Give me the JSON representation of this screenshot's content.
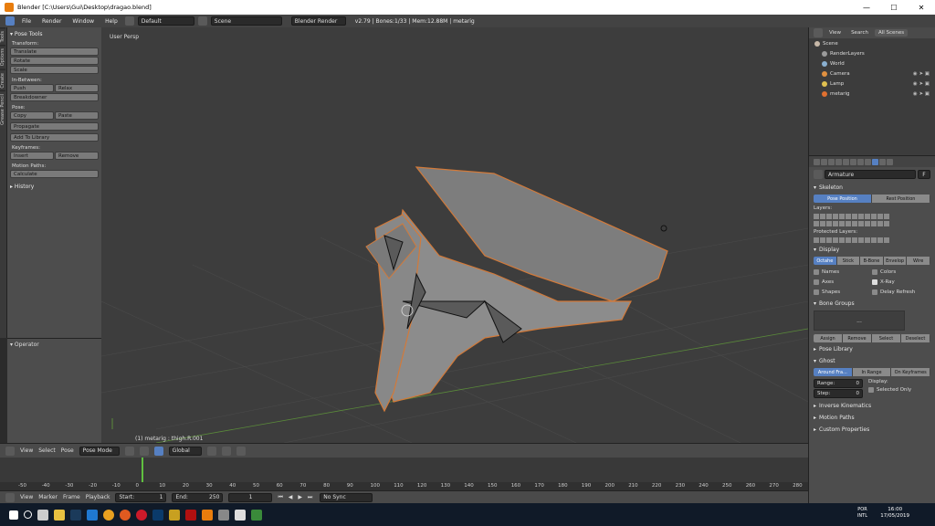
{
  "window": {
    "title": "Blender [C:\\Users\\Gui\\Desktop\\dragao.blend]",
    "minimize": "—",
    "maximize": "☐",
    "close": "✕"
  },
  "topbar": {
    "menus": [
      "File",
      "Render",
      "Window",
      "Help"
    ],
    "layout": "Default",
    "scene": "Scene",
    "engine": "Blender Render",
    "stats": "v2.79 | Bones:1/33 | Mem:12.88M | metarig"
  },
  "tooltabs": [
    "Tools",
    "Options",
    "Create",
    "Grease Pencil"
  ],
  "toolshelf": {
    "header": "▾ Pose Tools",
    "transform_label": "Transform:",
    "translate": "Translate",
    "rotate": "Rotate",
    "scale": "Scale",
    "inbetween_label": "In-Between:",
    "push": "Push",
    "relax": "Relax",
    "breakdowner": "Breakdowner",
    "pose_label": "Pose:",
    "copy": "Copy",
    "paste": "Paste",
    "propagate": "Propagate",
    "add_library": "Add To Library",
    "keyframes_label": "Keyframes:",
    "insert": "Insert",
    "remove": "Remove",
    "motion_label": "Motion Paths:",
    "calculate": "Calculate",
    "history": "▸ History"
  },
  "operator": {
    "title": "▾ Operator"
  },
  "viewport": {
    "view_label": "User Persp",
    "selection": "(1) metarig : thigh.R.001"
  },
  "viewport_header": {
    "view": "View",
    "select": "Select",
    "pose": "Pose",
    "mode": "Pose Mode",
    "orientation": "Global"
  },
  "timeline": {
    "ticks": [
      "-50",
      "-40",
      "-30",
      "-20",
      "-10",
      "0",
      "10",
      "20",
      "30",
      "40",
      "50",
      "60",
      "70",
      "80",
      "90",
      "100",
      "110",
      "120",
      "130",
      "140",
      "150",
      "160",
      "170",
      "180",
      "190",
      "200",
      "210",
      "220",
      "230",
      "240",
      "250",
      "260",
      "270",
      "280"
    ],
    "view": "View",
    "marker": "Marker",
    "frame": "Frame",
    "playback": "Playback",
    "start": "Start:",
    "start_val": "1",
    "end": "End:",
    "end_val": "250",
    "current": "1",
    "sync": "No Sync"
  },
  "outliner": {
    "tabs": [
      "View",
      "Search",
      "All Scenes"
    ],
    "rows": [
      {
        "name": "Scene",
        "color": "#c7b8a8"
      },
      {
        "name": "RenderLayers",
        "color": "#9a9a9a"
      },
      {
        "name": "World",
        "color": "#8ab0d0"
      },
      {
        "name": "Camera",
        "color": "#e09040"
      },
      {
        "name": "Lamp",
        "color": "#e0c050"
      },
      {
        "name": "metarig",
        "color": "#e07030"
      }
    ]
  },
  "properties": {
    "name": "Armature",
    "fake_user": "F",
    "skeleton": "Skeleton",
    "pose_position": "Pose Position",
    "rest_position": "Rest Position",
    "layers": "Layers:",
    "protected_layers": "Protected Layers:",
    "display": "Display",
    "display_modes": [
      "Octahe",
      "Stick",
      "B-Bone",
      "Envelop",
      "Wire"
    ],
    "names": "Names",
    "colors": "Colors",
    "axes": "Axes",
    "xray": "X-Ray",
    "shapes": "Shapes",
    "delay": "Delay Refresh",
    "bone_groups": "Bone Groups",
    "bg_dots": "...",
    "assign": "Assign",
    "remove": "Remove",
    "select": "Select",
    "deselect": "Deselect",
    "pose_library": "Pose Library",
    "ghost": "Ghost",
    "ghost_modes": [
      "Around Fra...",
      "In Range",
      "On Keyframes"
    ],
    "range": "Range:",
    "range_val": "0",
    "step": "Step:",
    "step_val": "0",
    "display_label": "Display:",
    "selected_only": "Selected Only",
    "inverse_kinematics": "Inverse Kinematics",
    "motion_paths": "Motion Paths",
    "custom_properties": "Custom Properties"
  },
  "taskbar": {
    "time": "16:00",
    "date": "17/05/2019",
    "lang1": "POR",
    "lang2": "INTL"
  }
}
